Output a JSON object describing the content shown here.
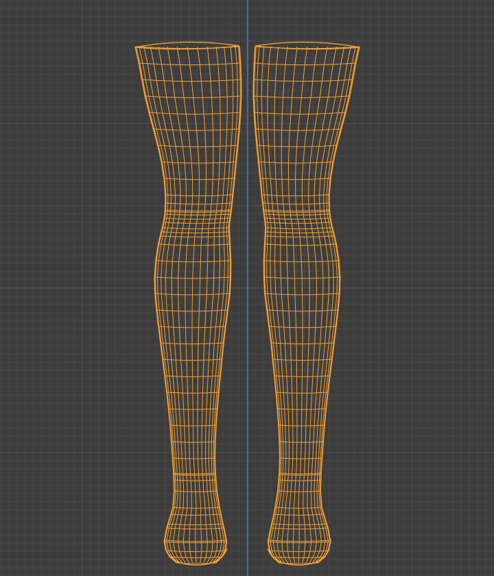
{
  "viewport": {
    "view": "front-orthographic",
    "background_color": "#3d3d3d",
    "minor_grid_color": "#464646",
    "major_grid_color": "#4f4f4f",
    "axis_color": "#4a6ec0",
    "wire_color": "#f5a030",
    "wire_dark_color": "#b46a1c"
  },
  "scene": {
    "objects": [
      {
        "name": "left-leg-mesh",
        "selected": true,
        "display": "wireframe"
      },
      {
        "name": "right-leg-mesh",
        "selected": true,
        "display": "wireframe"
      }
    ]
  }
}
